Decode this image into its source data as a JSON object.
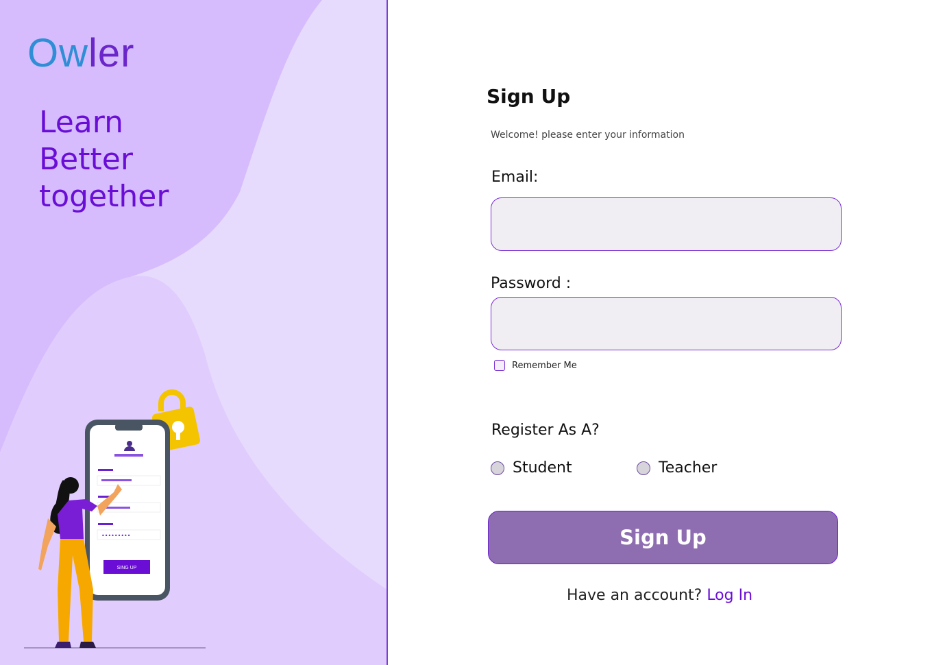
{
  "brand": {
    "logo_part1": "Ow",
    "logo_part2": "ler",
    "tagline_line1": "Learn",
    "tagline_line2": "Better",
    "tagline_line3": "together"
  },
  "illustration": {
    "phone_button_label": "SING UP",
    "password_dots": "•••••••••"
  },
  "form": {
    "title": "Sign Up",
    "subtitle": "Welcome! please enter your information",
    "email_label": "Email:",
    "email_value": "",
    "password_label": "Password :",
    "password_value": "",
    "remember_label": "Remember Me",
    "register_label": "Register As A?",
    "role_student": "Student",
    "role_teacher": "Teacher",
    "submit_label": "Sign Up",
    "login_prompt": "Have an account?",
    "login_link": "Log In"
  },
  "colors": {
    "accent": "#6a0ed6",
    "button": "#8e6db0",
    "panel_light": "#e7dbfd",
    "panel_dark": "#d6bcfd"
  }
}
